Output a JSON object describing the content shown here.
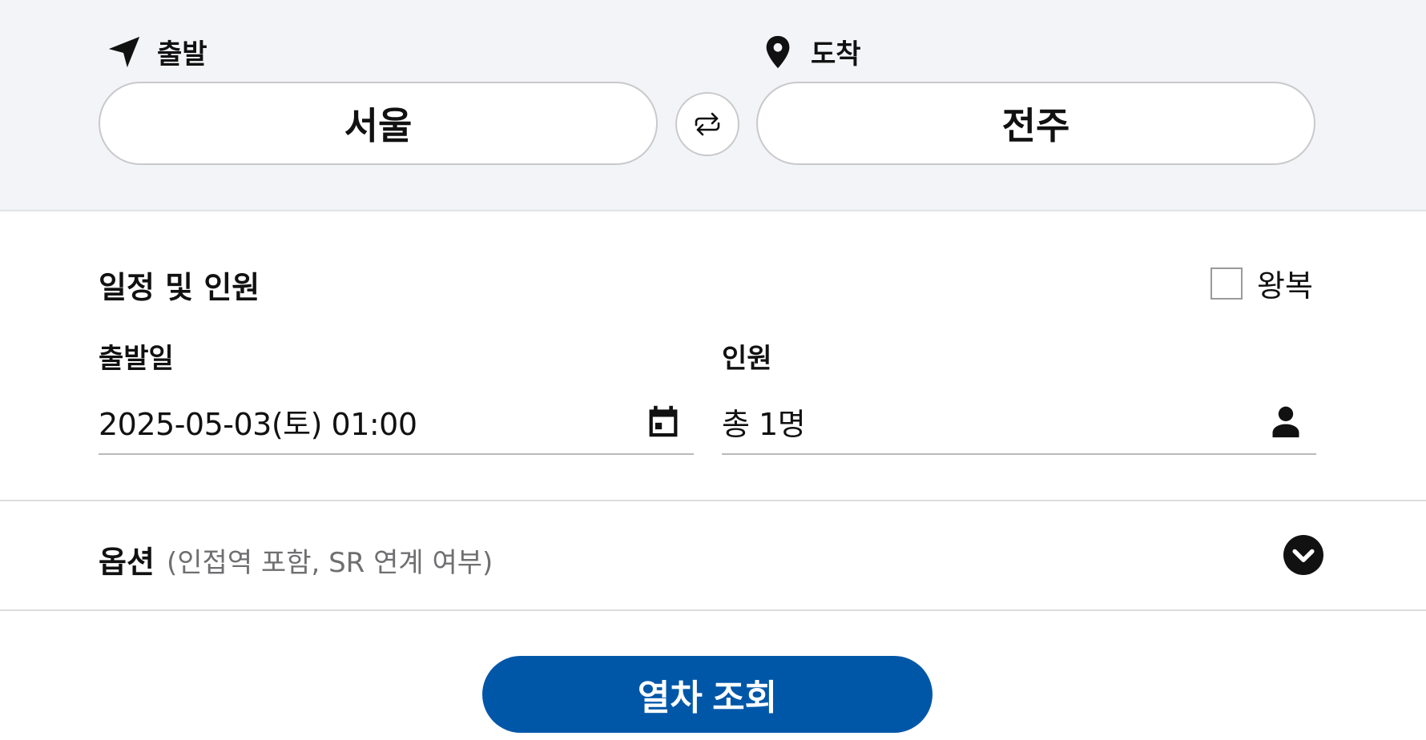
{
  "route": {
    "departure": {
      "label": "출발",
      "icon": "navigation-arrow-icon",
      "station": "서울"
    },
    "arrival": {
      "label": "도착",
      "icon": "map-pin-icon",
      "station": "전주"
    },
    "swap_icon": "swap-arrows-icon"
  },
  "schedule": {
    "title": "일정 및 인원",
    "roundtrip_label": "왕복",
    "roundtrip_checked": false,
    "date": {
      "label": "출발일",
      "value": "2025-05-03(토) 01:00",
      "icon": "calendar-icon"
    },
    "passengers": {
      "label": "인원",
      "value": "총 1명",
      "icon": "person-icon"
    }
  },
  "options": {
    "title": "옵션",
    "subtitle": "(인접역 포함, SR 연계 여부)",
    "icon": "chevron-down-icon"
  },
  "search_button": {
    "label": "열차 조회"
  },
  "colors": {
    "primary": "#0057a8",
    "band_background": "#f3f4f8",
    "text": "#111111",
    "muted_text": "#6f6f72"
  }
}
